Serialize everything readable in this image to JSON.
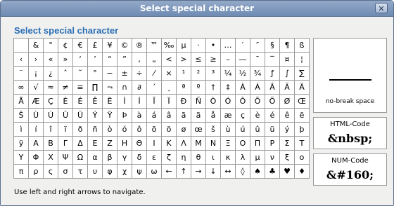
{
  "window": {
    "title": "Select special character",
    "close_glyph": "✕"
  },
  "heading": "Select special character",
  "grid": [
    [
      "",
      "&",
      "\"",
      "¢",
      "€",
      "£",
      "¥",
      "©",
      "®",
      "™",
      "‰",
      "µ",
      "·",
      "•",
      "…",
      "′",
      "″",
      "§",
      "¶",
      "ß"
    ],
    [
      "‹",
      "›",
      "«",
      "»",
      "‘",
      "’",
      "“",
      "”",
      "‚",
      "„",
      "<",
      ">",
      "≤",
      "≥",
      "–",
      "—",
      "¯",
      "‾",
      "¤",
      "¦"
    ],
    [
      "¨",
      "¡",
      "¿",
      "ˆ",
      "˜",
      "°",
      "−",
      "±",
      "÷",
      "⁄",
      "×",
      "¹",
      "²",
      "³",
      "¼",
      "½",
      "¾",
      "ƒ",
      "∫",
      "∑"
    ],
    [
      "∞",
      "√",
      "≈",
      "≠",
      "≡",
      "∏",
      "¬",
      "∩",
      "∂",
      "´",
      "¸",
      "ª",
      "º",
      "†",
      "‡",
      "À",
      "Á",
      "Â",
      "Ã",
      "Ä"
    ],
    [
      "Å",
      "Æ",
      "Ç",
      "È",
      "É",
      "Ê",
      "Ë",
      "Ì",
      "Í",
      "Î",
      "Ï",
      "Ð",
      "Ñ",
      "Ò",
      "Ó",
      "Ô",
      "Õ",
      "Ö",
      "Ø",
      "Œ"
    ],
    [
      "Š",
      "Ù",
      "Ú",
      "Û",
      "Ü",
      "Ý",
      "Ÿ",
      "Þ",
      "à",
      "á",
      "â",
      "ã",
      "ä",
      "å",
      "æ",
      "ç",
      "è",
      "é",
      "ê",
      "ë"
    ],
    [
      "ì",
      "í",
      "î",
      "ï",
      "ð",
      "ñ",
      "ò",
      "ó",
      "ô",
      "õ",
      "ö",
      "ø",
      "œ",
      "š",
      "ù",
      "ú",
      "û",
      "ü",
      "ý",
      "þ"
    ],
    [
      "ÿ",
      "Α",
      "Β",
      "Γ",
      "Δ",
      "Ε",
      "Ζ",
      "Η",
      "Θ",
      "Ι",
      "Κ",
      "Λ",
      "Μ",
      "Ν",
      "Ξ",
      "Ο",
      "Π",
      "Ρ",
      "Σ",
      "Τ"
    ],
    [
      "Υ",
      "Φ",
      "Χ",
      "Ψ",
      "Ω",
      "α",
      "β",
      "γ",
      "δ",
      "ε",
      "ζ",
      "η",
      "θ",
      "ι",
      "κ",
      "λ",
      "μ",
      "ν",
      "ξ",
      "ο"
    ],
    [
      "π",
      "ρ",
      "ς",
      "σ",
      "τ",
      "υ",
      "φ",
      "χ",
      "ψ",
      "ω",
      "←",
      "↑",
      "→",
      "↓",
      "↔",
      "◊",
      "♠",
      "♣",
      "♥",
      "♦"
    ]
  ],
  "preview": {
    "name": "no-break space"
  },
  "html_code": {
    "label": "HTML-Code",
    "value": "&nbsp;"
  },
  "num_code": {
    "label": "NUM-Code",
    "value": "&#160;"
  },
  "hint": "Use left and right arrows to navigate."
}
